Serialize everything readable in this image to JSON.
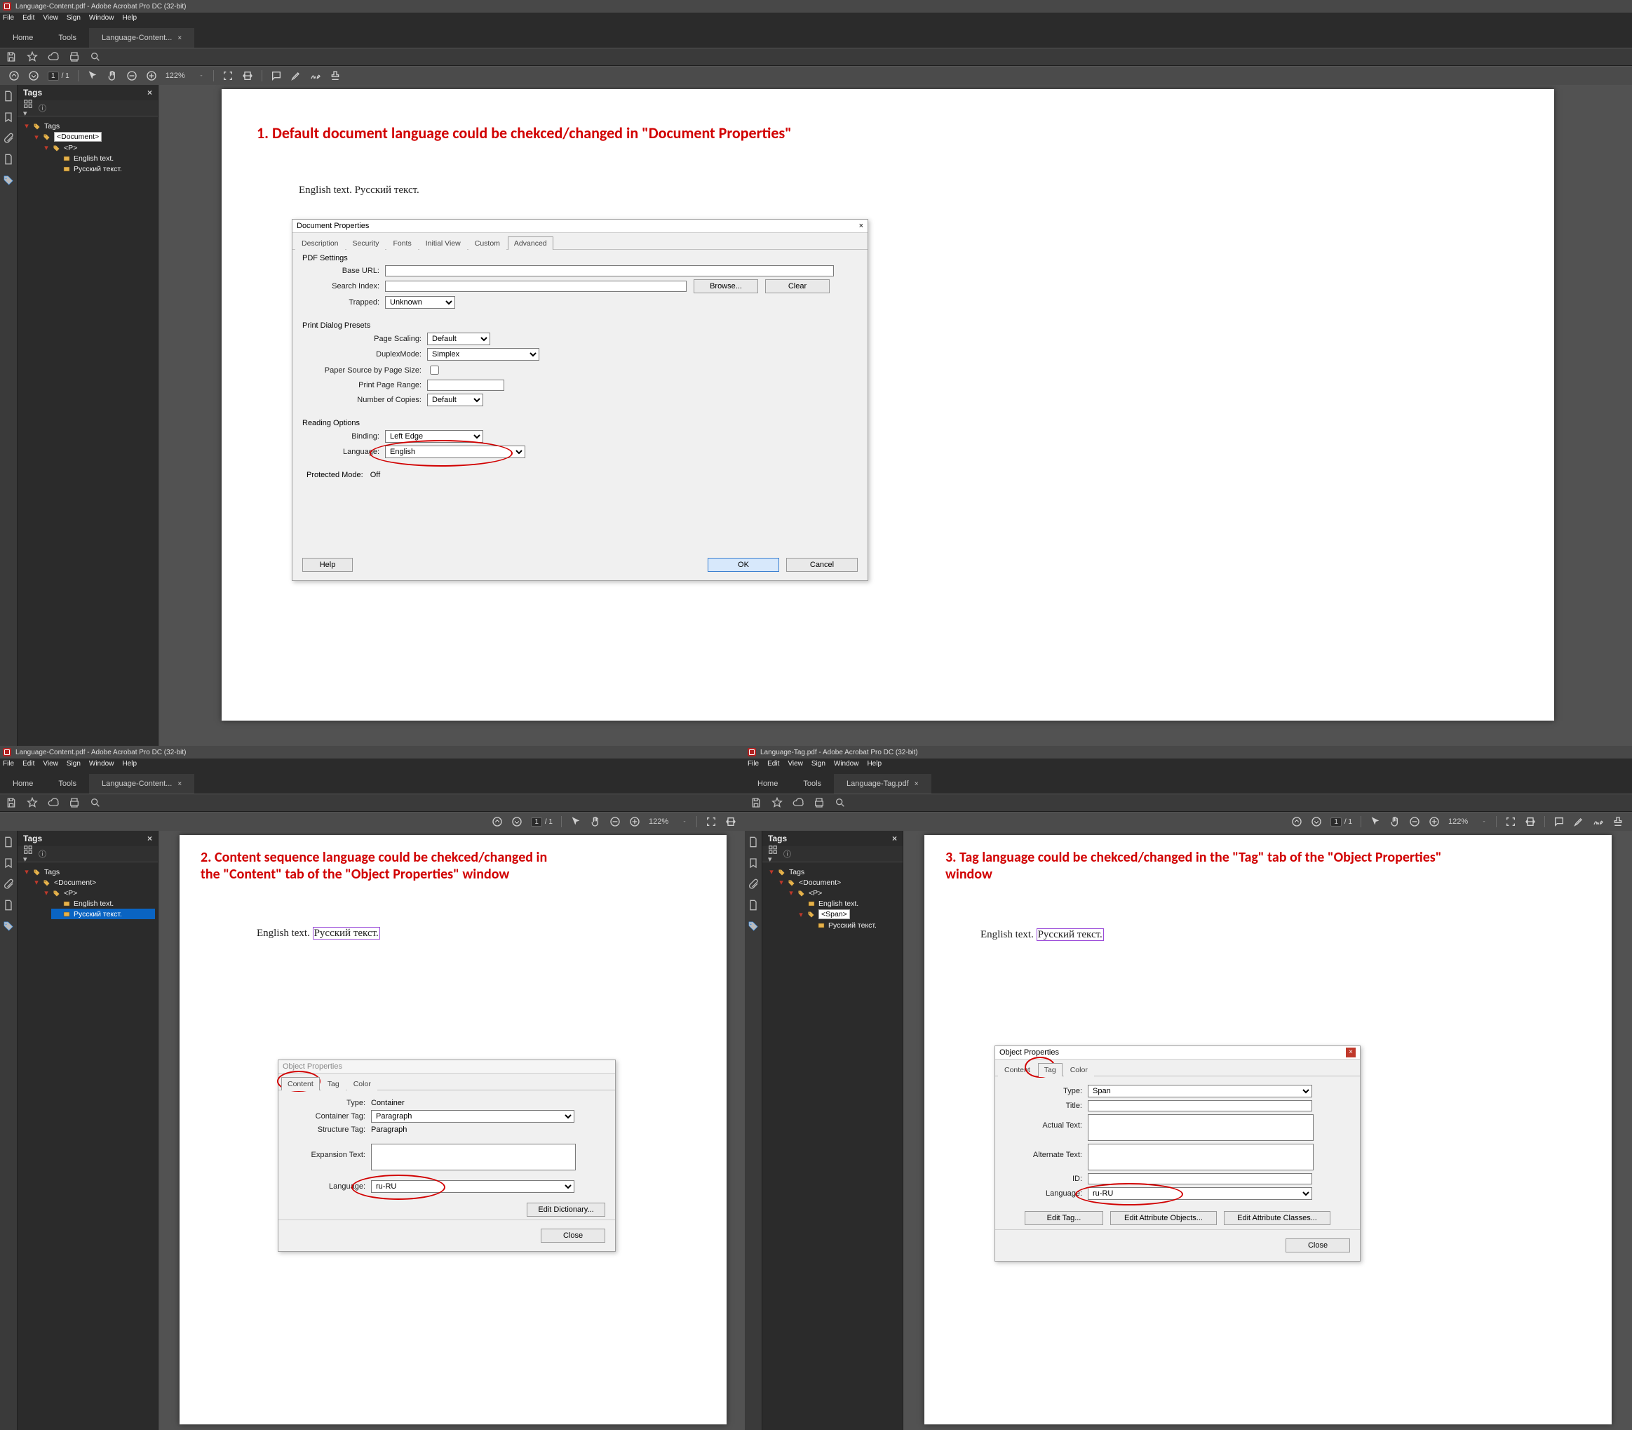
{
  "common": {
    "menus": [
      "File",
      "Edit",
      "View",
      "Sign",
      "Window",
      "Help"
    ],
    "top_tabs": {
      "home": "Home",
      "tools": "Tools"
    },
    "tags_panel": {
      "title": "Tags"
    },
    "page_indicator": {
      "current": "1",
      "of": "/ 1"
    },
    "zoom": "122%"
  },
  "panel1": {
    "window_title": "Language-Content.pdf - Adobe Acrobat Pro DC (32-bit)",
    "doc_tab": "Language-Content...",
    "annotation": "1. Default document language could be chekced/changed in \"Document Properties\"",
    "sample_text": "English text. Русский текст.",
    "tree": {
      "root": "Tags",
      "doc": "<Document>",
      "p": "<P>",
      "leafA": "English text.",
      "leafB": "Русский текст."
    },
    "dlg": {
      "title": "Document Properties",
      "tabs": [
        "Description",
        "Security",
        "Fonts",
        "Initial View",
        "Custom",
        "Advanced"
      ],
      "active_tab": "Advanced",
      "pdf_settings": "PDF Settings",
      "base_url": "Base URL:",
      "search_index": "Search Index:",
      "browse": "Browse...",
      "clear": "Clear",
      "trapped": "Trapped:",
      "trapped_value": "Unknown",
      "print_presets": "Print Dialog Presets",
      "page_scaling": "Page Scaling:",
      "page_scaling_value": "Default",
      "duplex": "DuplexMode:",
      "duplex_value": "Simplex",
      "paper_source": "Paper Source by Page Size:",
      "print_range": "Print Page Range:",
      "copies": "Number of Copies:",
      "copies_value": "Default",
      "reading_options": "Reading Options",
      "binding": "Binding:",
      "binding_value": "Left Edge",
      "language": "Language:",
      "language_value": "English",
      "protected_mode": "Protected Mode:",
      "protected_value": "Off",
      "help": "Help",
      "ok": "OK",
      "cancel": "Cancel"
    }
  },
  "panel2": {
    "window_title": "Language-Content.pdf - Adobe Acrobat Pro DC (32-bit)",
    "doc_tab": "Language-Content...",
    "annotation": "2. Content sequence language could be chekced/changed in the \"Content\" tab of the \"Object Properties\" window",
    "sample_en": "English text. ",
    "sample_ru": "Русский текст.",
    "tree": {
      "root": "Tags",
      "doc": "<Document>",
      "p": "<P>",
      "leafA": "English text.",
      "leafB": "Русский текст."
    },
    "dlg": {
      "title": "Object Properties",
      "tabs": [
        "Content",
        "Tag",
        "Color"
      ],
      "active_tab": "Content",
      "type": "Type:",
      "type_value": "Container",
      "ctag": "Container Tag:",
      "ctag_value": "Paragraph",
      "stag": "Structure Tag:",
      "stag_value": "Paragraph",
      "etext": "Expansion Text:",
      "language": "Language:",
      "language_value": "ru-RU",
      "edit_dict": "Edit Dictionary...",
      "close": "Close"
    }
  },
  "panel3": {
    "window_title": "Language-Tag.pdf - Adobe Acrobat Pro DC (32-bit)",
    "doc_tab": "Language-Tag.pdf",
    "annotation": "3. Tag language could be chekced/changed in the \"Tag\" tab of the \"Object Properties\" window",
    "sample_en": "English text. ",
    "sample_ru": "Русский текст.",
    "tree": {
      "root": "Tags",
      "doc": "<Document>",
      "p": "<P>",
      "span": "<Span>",
      "leafA": "English text.",
      "leafB": "Русский текст."
    },
    "dlg": {
      "title": "Object Properties",
      "tabs": [
        "Content",
        "Tag",
        "Color"
      ],
      "active_tab": "Tag",
      "type": "Type:",
      "type_value": "Span",
      "titlel": "Title:",
      "actual": "Actual Text:",
      "alt": "Alternate Text:",
      "id": "ID:",
      "language": "Language:",
      "language_value": "ru-RU",
      "edit_tag": "Edit Tag...",
      "edit_attr_obj": "Edit Attribute Objects...",
      "edit_attr_cls": "Edit Attribute Classes...",
      "close": "Close"
    }
  }
}
